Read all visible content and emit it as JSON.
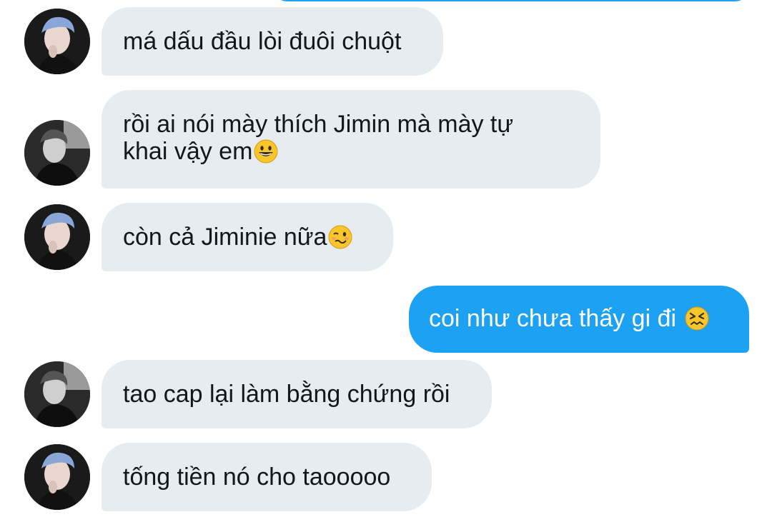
{
  "messages": [
    {
      "sender": "them",
      "avatar": "avatar-blue-hair",
      "text": "má dấu đầu lòi đuôi chuột"
    },
    {
      "sender": "them",
      "avatar": "avatar-grayscale",
      "text": "rồi ai nói mày thích Jimin mà mày tự khai vậy em",
      "text_line1": "rồi ai nói mày thích Jimin mà mày tự",
      "text_line2": "khai vậy em",
      "emoji": "grinning-face-emoji"
    },
    {
      "sender": "them",
      "avatar": "avatar-blue-hair",
      "text": "còn cả Jiminie nữa",
      "emoji": "woozy-face-emoji"
    },
    {
      "sender": "me",
      "text": "coi như chưa thấy gi đi ",
      "emoji": "confounded-face-emoji"
    },
    {
      "sender": "them",
      "avatar": "avatar-grayscale",
      "text": "tao cap lại làm bằng chứng rồi"
    },
    {
      "sender": "them",
      "avatar": "avatar-blue-hair",
      "text": "tống tiền nó cho taooooo"
    }
  ],
  "colors": {
    "incoming_bubble": "#e6ecf0",
    "outgoing_bubble": "#1da1f2",
    "incoming_text": "#14171a",
    "outgoing_text": "#ffffff"
  }
}
